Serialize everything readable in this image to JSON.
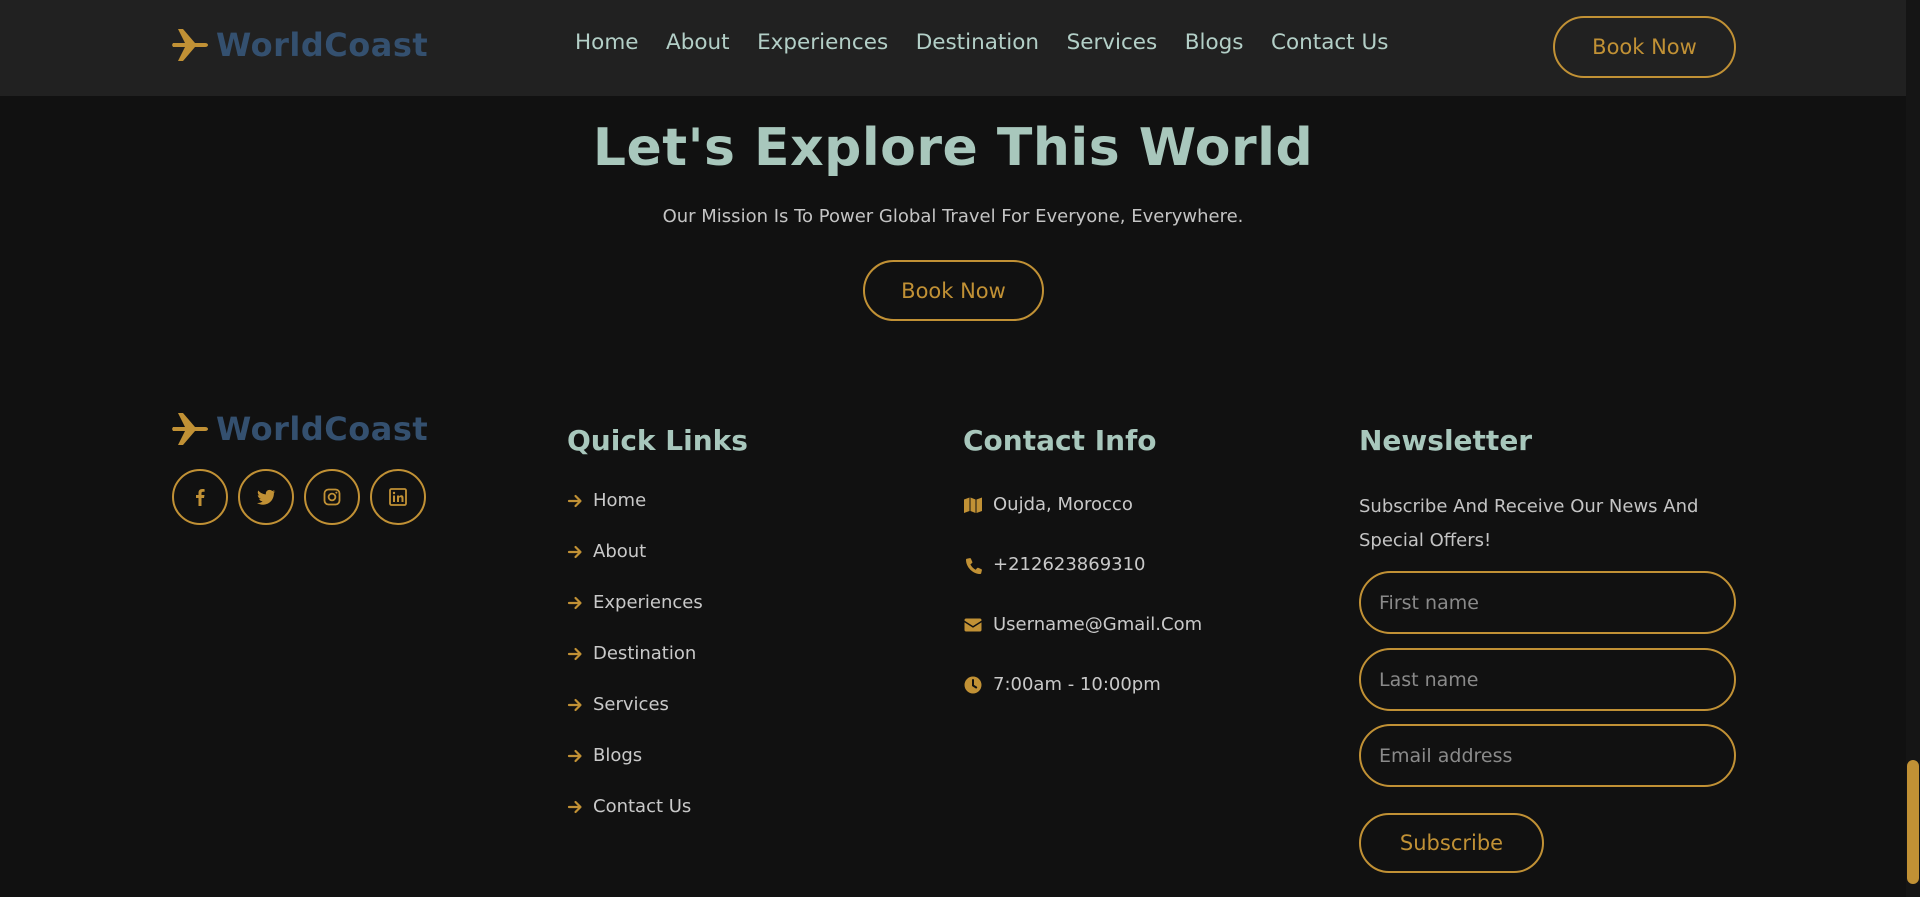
{
  "brand": {
    "name": "WorldCoast",
    "icon": "airplane-icon",
    "color": "#34506f"
  },
  "nav": {
    "links": [
      "Home",
      "About",
      "Experiences",
      "Destination",
      "Services",
      "Blogs",
      "Contact Us"
    ],
    "cta": "Book Now"
  },
  "hero": {
    "title": "Let's Explore This World",
    "subtitle": "Our Mission Is To Power Global Travel For Everyone, Everywhere.",
    "cta": "Book Now"
  },
  "footer": {
    "brand": "WorldCoast",
    "socials": [
      "facebook-icon",
      "twitter-icon",
      "instagram-icon",
      "linkedin-icon"
    ],
    "quick_links": {
      "heading": "Quick Links",
      "items": [
        "Home",
        "About",
        "Experiences",
        "Destination",
        "Services",
        "Blogs",
        "Contact Us"
      ]
    },
    "contact": {
      "heading": "Contact Info",
      "location": "Oujda, Morocco",
      "phone": "+212623869310",
      "email": "Username@Gmail.Com",
      "hours": "7:00am - 10:00pm"
    },
    "newsletter": {
      "heading": "Newsletter",
      "text": "Subscribe And Receive Our News And Special Offers!",
      "first_name_placeholder": "First name",
      "last_name_placeholder": "Last name",
      "email_placeholder": "Email address",
      "button": "Subscribe"
    }
  },
  "colors": {
    "accent": "#c19135",
    "heading": "#a8c7bc",
    "background": "#111111",
    "navbar": "#212121"
  }
}
